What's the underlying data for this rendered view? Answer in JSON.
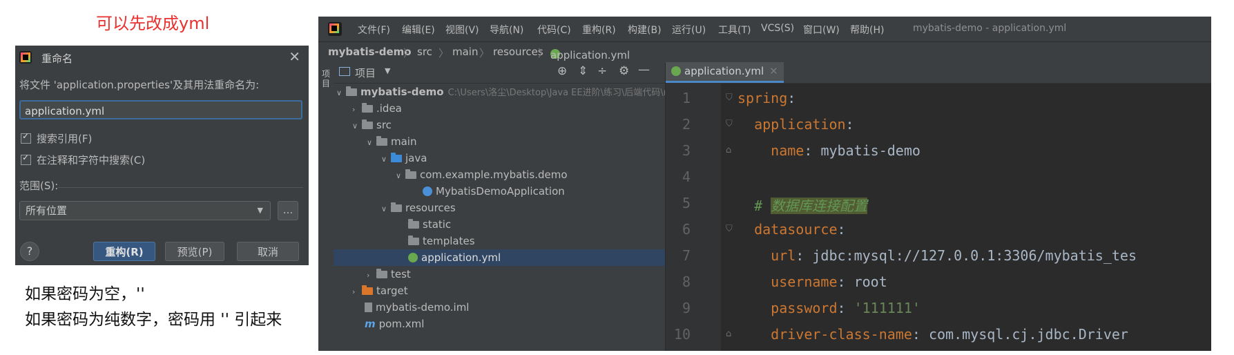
{
  "annotation": {
    "title": "可以先改成yml",
    "note_line1": "如果密码为空，''",
    "note_line2": "如果密码为纯数字，密码用 '' 引起来"
  },
  "dialog": {
    "title": "重命名",
    "prompt": "将文件 'application.properties'及其用法重命名为:",
    "input_value": "application.yml",
    "checkbox_search_refs": "搜索引用(F)",
    "checkbox_search_comments": "在注释和字符中搜索(C)",
    "scope_label": "范围(S):",
    "scope_value": "所有位置",
    "more_button": "...",
    "help": "?",
    "btn_refactor": "重构(R)",
    "btn_preview": "预览(P)",
    "btn_cancel": "取消"
  },
  "ide": {
    "menu": [
      "文件(F)",
      "编辑(E)",
      "视图(V)",
      "导航(N)",
      "代码(C)",
      "重构(R)",
      "构建(B)",
      "运行(U)",
      "工具(T)",
      "VCS(S)",
      "窗口(W)",
      "帮助(H)"
    ],
    "window_title": "mybatis-demo - application.yml",
    "breadcrumbs": [
      "mybatis-demo",
      "src",
      "main",
      "resources",
      "application.yml"
    ],
    "side_strip_label": "项目",
    "project_header": "项目",
    "tree": {
      "root": "mybatis-demo",
      "root_path": "C:\\Users\\洛尘\\Desktop\\Java EE进阶\\练习\\后端代码\\m",
      "idea": ".idea",
      "src": "src",
      "main": "main",
      "java": "java",
      "package": "com.example.mybatis.demo",
      "app_class": "MybatisDemoApplication",
      "resources": "resources",
      "static": "static",
      "templates": "templates",
      "application_yml": "application.yml",
      "test": "test",
      "target": "target",
      "iml": "mybatis-demo.iml",
      "pom": "pom.xml"
    },
    "editor_tab": "application.yml",
    "code": {
      "l1_key": "spring",
      "l2_key": "application",
      "l3_key": "name",
      "l3_val": "mybatis-demo",
      "l5_comment_hash": "#",
      "l5_comment": "数据库连接配置",
      "l6_key": "datasource",
      "l7_key": "url",
      "l7_val": "jdbc:mysql://127.0.0.1:3306/mybatis_tes",
      "l8_key": "username",
      "l8_val": "root",
      "l9_key": "password",
      "l9_val": "'111111'",
      "l10_key": "driver-class-name",
      "l10_val": "com.mysql.cj.jdbc.Driver"
    },
    "line_numbers": [
      "1",
      "2",
      "3",
      "4",
      "5",
      "6",
      "7",
      "8",
      "9",
      "10"
    ]
  },
  "colors": {
    "accent": "#e8322f",
    "ide_bg": "#2b2b2b",
    "panel_bg": "#3c3f41",
    "selection": "#2f4562",
    "key": "#cc7832",
    "string": "#6a8759"
  }
}
